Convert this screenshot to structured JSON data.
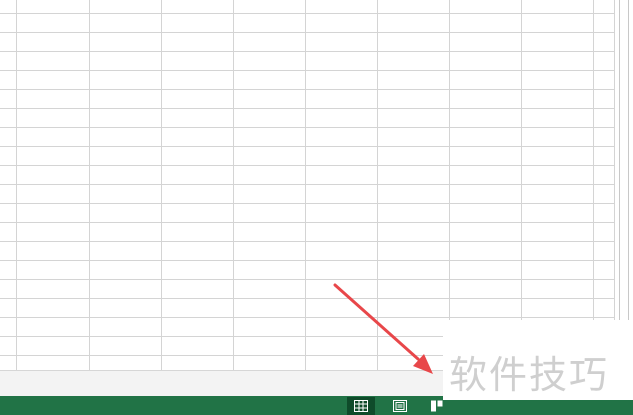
{
  "spreadsheet": {
    "grid_line_color": "#d4d4d4"
  },
  "statusbar": {
    "background_color": "#217346",
    "view_buttons": [
      {
        "name": "normal-view",
        "icon": "grid-view-icon",
        "active": true
      },
      {
        "name": "page-layout-view",
        "icon": "page-layout-icon",
        "active": false
      },
      {
        "name": "page-break-preview",
        "icon": "page-break-icon",
        "active": false
      }
    ]
  },
  "annotation": {
    "arrow_color": "#e8474a",
    "arrow_icon": "red-arrow-icon"
  },
  "watermark": {
    "text": "软件技巧"
  }
}
